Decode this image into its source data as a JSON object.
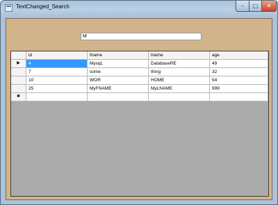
{
  "window": {
    "title": "TextChanged_Search",
    "minimize_glyph": "–",
    "maximize_glyph": "□",
    "close_glyph": "✕"
  },
  "search": {
    "value": "M"
  },
  "grid": {
    "columns": [
      "id",
      "fname",
      "lname",
      "age"
    ],
    "rows": [
      {
        "id": "4",
        "fname": "MysqL",
        "lname": "DatabaseRE",
        "age": "49"
      },
      {
        "id": "7",
        "fname": "some",
        "lname": "thing",
        "age": "32"
      },
      {
        "id": "10",
        "fname": "WOR",
        "lname": "HOME",
        "age": "54"
      },
      {
        "id": "25",
        "fname": "MyFNAME",
        "lname": "MyLNAME",
        "age": "999"
      }
    ],
    "current_row_marker": "▶",
    "new_row_marker": "✱"
  },
  "colors": {
    "client_background": "#d2b48c",
    "grid_background": "#ababab",
    "selection": "#3399ff"
  }
}
